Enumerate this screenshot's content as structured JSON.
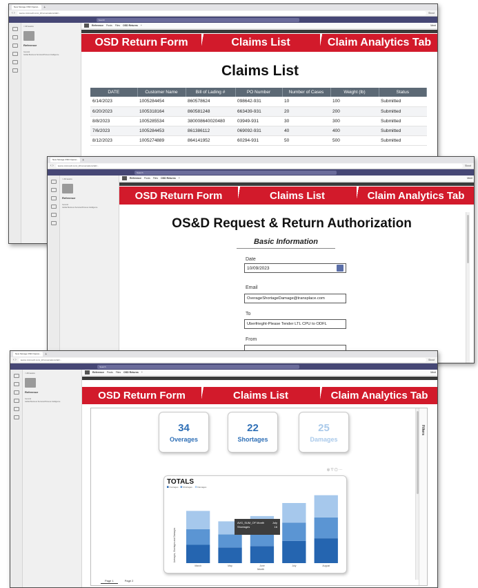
{
  "browser": {
    "tab_title": "New Storage OSD Operat...",
    "new_tab": "+",
    "url": "teams.microsoft.com/_#/conversations/tab/...",
    "teams_search": "Search",
    "profile_short": "Skout"
  },
  "sidebar": {
    "back_label": "< All teams",
    "team_name": "Reference",
    "general_label": "General",
    "channel_label": "Global Business Services/Process Intelligence"
  },
  "channel_bar": {
    "name": "Reference",
    "posts": "Posts",
    "files": "Files",
    "active_tab": "OSD Returns",
    "add": "+",
    "meet": "Meet"
  },
  "app_tabs": {
    "return_form": "OSD Return Form",
    "claims_list": "Claims List",
    "analytics": "Claim Analytics Tab"
  },
  "claims": {
    "title": "Claims List",
    "columns": [
      "DATE",
      "Customer Name",
      "Bill of Lading #",
      "PO Number",
      "Number of Cases",
      "Weight (lb)",
      "Status"
    ],
    "rows": [
      [
        "6/14/2023",
        "1005284454",
        "860578624",
        "098642-931",
        "10",
        "100",
        "Submitted"
      ],
      [
        "6/20/2023",
        "1005318164",
        "860581248",
        "663439-931",
        "20",
        "200",
        "Submitted"
      ],
      [
        "8/8/2023",
        "1005285534",
        "380008640020480",
        "03949-931",
        "30",
        "300",
        "Submitted"
      ],
      [
        "7/6/2023",
        "1005284453",
        "861386112",
        "069092-931",
        "40",
        "400",
        "Submitted"
      ],
      [
        "8/12/2023",
        "1005274889",
        "864141952",
        "60294-931",
        "50",
        "500",
        "Submitted"
      ]
    ]
  },
  "form": {
    "title": "OS&D Request & Return Authorization",
    "section": "Basic Information",
    "date_label": "Date",
    "date_value": "10/09/2023",
    "email_label": "Email",
    "email_value": "OverageShortageDamage@transplace.com",
    "to_label": "To",
    "to_value": "Uberfrieght-Please Tender LTL CPU to ODFL",
    "from_label": "From"
  },
  "analytics": {
    "kpis": [
      {
        "value": "34",
        "label": "Overages",
        "color": "#2e6fb6"
      },
      {
        "value": "22",
        "label": "Shortages",
        "color": "#2e6fb6"
      },
      {
        "value": "25",
        "label": "Damages",
        "color": "#a9c9ea"
      }
    ],
    "filters_label": "Filters",
    "page_tabs": [
      "Page 1",
      "Page 2"
    ],
    "tooltip_line1": "AVG_SUM_OF Month",
    "tooltip_val1": "July",
    "tooltip_line2": "Shortages",
    "tooltip_val2": "16"
  },
  "chart_data": {
    "type": "bar",
    "stacked": true,
    "title": "TOTALS",
    "legend_placement": "top-left",
    "legend": [
      "Overages",
      "Shortages",
      "Damages"
    ],
    "categories": [
      "March",
      "May",
      "June",
      "July",
      "August"
    ],
    "series": [
      {
        "name": "Overages",
        "values": [
          14,
          12,
          13,
          17,
          19
        ],
        "color": "#2565b0"
      },
      {
        "name": "Shortages",
        "values": [
          12,
          10,
          10,
          14,
          16
        ],
        "color": "#5b95d3"
      },
      {
        "name": "Damages",
        "values": [
          14,
          10,
          13,
          15,
          17
        ],
        "color": "#a6c8ec"
      }
    ],
    "xlabel": "Month",
    "ylabel": "Averages, Shortages and Damages",
    "ylim": [
      0,
      55
    ]
  }
}
